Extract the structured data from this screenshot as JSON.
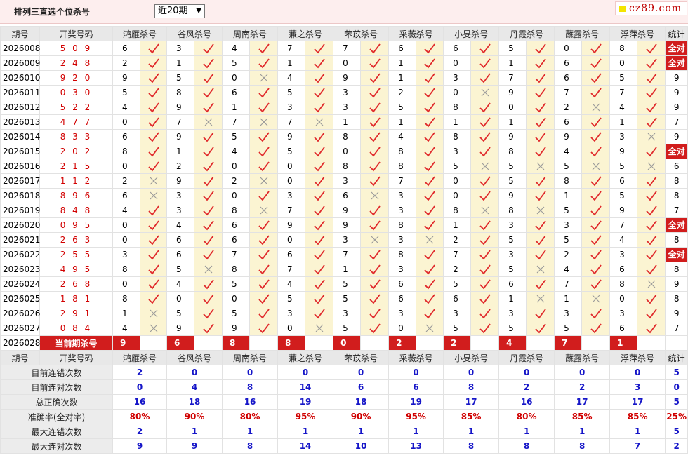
{
  "header": {
    "title": "排列三直选个位杀号",
    "period_select": "近20期",
    "logo": "cz89.com"
  },
  "columns": {
    "issue": "期号",
    "draw": "开奖号码",
    "experts": [
      "鸿雁杀号",
      "谷风杀号",
      "周南杀号",
      "蒹之杀号",
      "芣苡杀号",
      "采薇杀号",
      "小旻杀号",
      "丹霞杀号",
      "蘸露杀号",
      "浮萍杀号"
    ],
    "total": "统计"
  },
  "rows": [
    {
      "issue": "2026008",
      "draw": "5 0 9",
      "kills": [
        6,
        3,
        4,
        7,
        7,
        6,
        6,
        5,
        0,
        8
      ],
      "hits": [
        1,
        1,
        1,
        1,
        1,
        1,
        1,
        1,
        1,
        1
      ],
      "total": "全对",
      "all": true
    },
    {
      "issue": "2026009",
      "draw": "2 4 8",
      "kills": [
        2,
        1,
        5,
        1,
        0,
        1,
        0,
        1,
        6,
        0
      ],
      "hits": [
        1,
        1,
        1,
        1,
        1,
        1,
        1,
        1,
        1,
        1
      ],
      "total": "全对",
      "all": true
    },
    {
      "issue": "2026010",
      "draw": "9 2 0",
      "kills": [
        9,
        5,
        0,
        4,
        9,
        1,
        3,
        7,
        6,
        5
      ],
      "hits": [
        1,
        1,
        0,
        1,
        1,
        1,
        1,
        1,
        1,
        1
      ],
      "total": "9",
      "all": false
    },
    {
      "issue": "2026011",
      "draw": "0 3 0",
      "kills": [
        5,
        8,
        6,
        5,
        3,
        2,
        0,
        9,
        7,
        7
      ],
      "hits": [
        1,
        1,
        1,
        1,
        1,
        1,
        0,
        1,
        1,
        1
      ],
      "total": "9",
      "all": false
    },
    {
      "issue": "2026012",
      "draw": "5 2 2",
      "kills": [
        4,
        9,
        1,
        3,
        3,
        5,
        8,
        0,
        2,
        4
      ],
      "hits": [
        1,
        1,
        1,
        1,
        1,
        1,
        1,
        1,
        0,
        1
      ],
      "total": "9",
      "all": false
    },
    {
      "issue": "2026013",
      "draw": "4 7 7",
      "kills": [
        0,
        7,
        7,
        7,
        1,
        1,
        1,
        1,
        6,
        1
      ],
      "hits": [
        1,
        0,
        0,
        0,
        1,
        1,
        1,
        1,
        1,
        1
      ],
      "total": "7",
      "all": false
    },
    {
      "issue": "2026014",
      "draw": "8 3 3",
      "kills": [
        6,
        9,
        5,
        9,
        8,
        4,
        8,
        9,
        9,
        3
      ],
      "hits": [
        1,
        1,
        1,
        1,
        1,
        1,
        1,
        1,
        1,
        0
      ],
      "total": "9",
      "all": false
    },
    {
      "issue": "2026015",
      "draw": "2 0 2",
      "kills": [
        8,
        1,
        4,
        5,
        0,
        8,
        3,
        8,
        4,
        9
      ],
      "hits": [
        1,
        1,
        1,
        1,
        1,
        1,
        1,
        1,
        1,
        1
      ],
      "total": "全对",
      "all": true
    },
    {
      "issue": "2026016",
      "draw": "2 1 5",
      "kills": [
        0,
        2,
        0,
        0,
        8,
        8,
        5,
        5,
        5,
        5
      ],
      "hits": [
        1,
        1,
        1,
        1,
        1,
        1,
        0,
        0,
        0,
        0
      ],
      "total": "6",
      "all": false
    },
    {
      "issue": "2026017",
      "draw": "1 1 2",
      "kills": [
        2,
        9,
        2,
        0,
        3,
        7,
        0,
        5,
        8,
        6
      ],
      "hits": [
        0,
        1,
        0,
        1,
        1,
        1,
        1,
        1,
        1,
        1
      ],
      "total": "8",
      "all": false
    },
    {
      "issue": "2026018",
      "draw": "8 9 6",
      "kills": [
        6,
        3,
        0,
        3,
        6,
        3,
        0,
        9,
        1,
        5
      ],
      "hits": [
        0,
        1,
        1,
        1,
        0,
        1,
        1,
        1,
        1,
        1
      ],
      "total": "8",
      "all": false
    },
    {
      "issue": "2026019",
      "draw": "8 4 8",
      "kills": [
        4,
        3,
        8,
        7,
        9,
        3,
        8,
        8,
        5,
        9
      ],
      "hits": [
        1,
        1,
        0,
        1,
        1,
        1,
        0,
        0,
        1,
        1
      ],
      "total": "7",
      "all": false
    },
    {
      "issue": "2026020",
      "draw": "0 9 5",
      "kills": [
        0,
        4,
        6,
        9,
        9,
        8,
        1,
        3,
        3,
        7
      ],
      "hits": [
        1,
        1,
        1,
        1,
        1,
        1,
        1,
        1,
        1,
        1
      ],
      "total": "全对",
      "all": true
    },
    {
      "issue": "2026021",
      "draw": "2 6 3",
      "kills": [
        0,
        6,
        6,
        0,
        3,
        3,
        2,
        5,
        5,
        4
      ],
      "hits": [
        1,
        1,
        1,
        1,
        0,
        0,
        1,
        1,
        1,
        1
      ],
      "total": "8",
      "all": false
    },
    {
      "issue": "2026022",
      "draw": "2 5 5",
      "kills": [
        3,
        6,
        7,
        6,
        7,
        8,
        7,
        3,
        2,
        3
      ],
      "hits": [
        1,
        1,
        1,
        1,
        1,
        1,
        1,
        1,
        1,
        1
      ],
      "total": "全对",
      "all": true
    },
    {
      "issue": "2026023",
      "draw": "4 9 5",
      "kills": [
        8,
        5,
        8,
        7,
        1,
        3,
        2,
        5,
        4,
        6
      ],
      "hits": [
        1,
        0,
        1,
        1,
        1,
        1,
        1,
        0,
        1,
        1
      ],
      "total": "8",
      "all": false
    },
    {
      "issue": "2026024",
      "draw": "2 6 8",
      "kills": [
        0,
        4,
        5,
        4,
        5,
        6,
        5,
        6,
        7,
        8
      ],
      "hits": [
        1,
        1,
        1,
        1,
        1,
        1,
        1,
        1,
        1,
        0
      ],
      "total": "9",
      "all": false
    },
    {
      "issue": "2026025",
      "draw": "1 8 1",
      "kills": [
        8,
        0,
        0,
        5,
        5,
        6,
        6,
        1,
        1,
        0
      ],
      "hits": [
        1,
        1,
        1,
        1,
        1,
        1,
        1,
        0,
        0,
        1
      ],
      "total": "8",
      "all": false
    },
    {
      "issue": "2026026",
      "draw": "2 9 1",
      "kills": [
        1,
        5,
        5,
        3,
        3,
        3,
        3,
        3,
        3,
        3
      ],
      "hits": [
        0,
        1,
        1,
        1,
        1,
        1,
        1,
        1,
        1,
        1
      ],
      "total": "9",
      "all": false
    },
    {
      "issue": "2026027",
      "draw": "0 8 4",
      "kills": [
        4,
        9,
        9,
        0,
        5,
        0,
        5,
        5,
        5,
        6
      ],
      "hits": [
        0,
        1,
        1,
        0,
        1,
        0,
        1,
        1,
        1,
        1
      ],
      "total": "7",
      "all": false
    }
  ],
  "current": {
    "issue": "2026028",
    "label": "当前期杀号",
    "kills": [
      "9",
      "6",
      "8",
      "8",
      "0",
      "2",
      "2",
      "4",
      "7",
      "1"
    ]
  },
  "stats": [
    {
      "label": "目前连错次数",
      "values": [
        "2",
        "0",
        "0",
        "0",
        "0",
        "0",
        "0",
        "0",
        "0",
        "0",
        "5"
      ],
      "style": "blue"
    },
    {
      "label": "目前连对次数",
      "values": [
        "0",
        "4",
        "8",
        "14",
        "6",
        "6",
        "8",
        "2",
        "2",
        "3",
        "0"
      ],
      "style": "blue"
    },
    {
      "label": "总正确次数",
      "values": [
        "16",
        "18",
        "16",
        "19",
        "18",
        "19",
        "17",
        "16",
        "17",
        "17",
        "5"
      ],
      "style": "blue"
    },
    {
      "label": "准确率(全对率)",
      "values": [
        "80%",
        "90%",
        "80%",
        "95%",
        "90%",
        "95%",
        "85%",
        "80%",
        "85%",
        "85%",
        "25%"
      ],
      "style": "red"
    },
    {
      "label": "最大连错次数",
      "values": [
        "2",
        "1",
        "1",
        "1",
        "1",
        "1",
        "1",
        "1",
        "1",
        "1",
        "5"
      ],
      "style": "blue"
    },
    {
      "label": "最大连对次数",
      "values": [
        "9",
        "9",
        "8",
        "14",
        "10",
        "13",
        "8",
        "8",
        "8",
        "7",
        "2"
      ],
      "style": "blue"
    }
  ],
  "colors": {
    "accent_red": "#d11d1d",
    "check": "#e0282a",
    "cross": "#9a9a9a",
    "stat_blue": "#1515c8",
    "result_bg": "#fbf4d2"
  }
}
